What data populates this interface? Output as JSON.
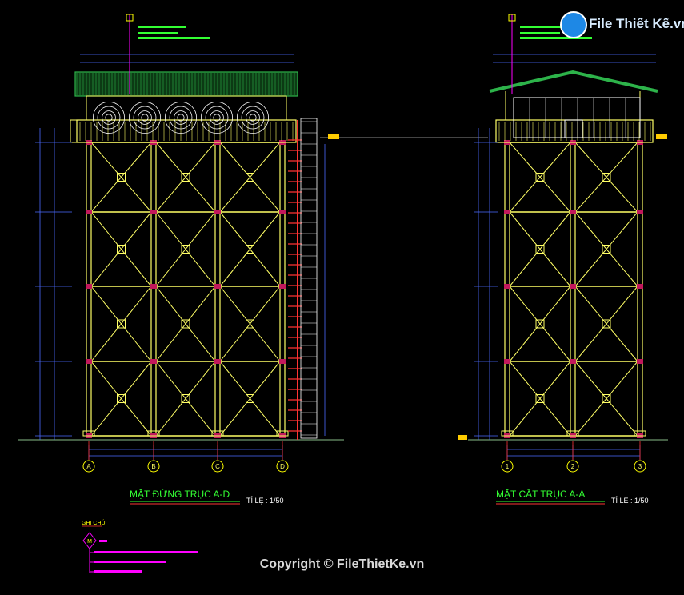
{
  "watermark": "File Thiết Kế.vn",
  "copyright": "Copyright © FileThietKe.vn",
  "left_view": {
    "title": "MẶT ĐỨNG TRỤC A-D",
    "scale": "TỈ LỆ : 1/50",
    "axes": [
      "A",
      "B",
      "C",
      "D"
    ]
  },
  "right_view": {
    "title": "MẶT CẮT TRỤC A-A",
    "scale": "TỈ LỆ : 1/50",
    "axes": [
      "1",
      "2",
      "3"
    ]
  },
  "legend": {
    "heading": "GHI CHÚ",
    "marker": "M"
  },
  "colors": {
    "frame": "#ffff66",
    "dimension": "#4b6bff",
    "axis": "#ff3333",
    "accent": "#33ff33",
    "magenta": "#ff00ff",
    "roof": "#2db34a"
  }
}
